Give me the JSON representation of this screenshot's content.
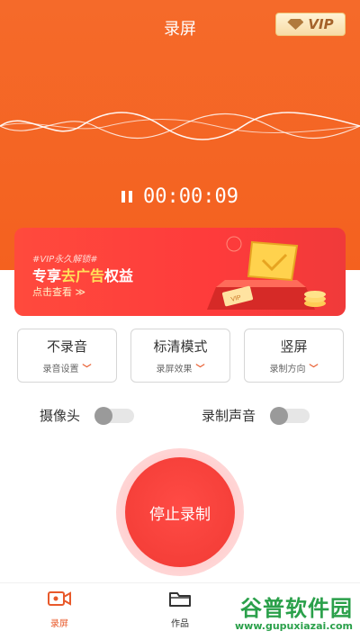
{
  "header": {
    "title": "录屏",
    "vip_label": "VIP"
  },
  "timer": {
    "value": "00:00:09"
  },
  "banner": {
    "tag": "#VIP永久解锁#",
    "title_prefix": "专享",
    "title_highlight": "去广告",
    "title_suffix": "权益",
    "cta": "点击查看 ≫",
    "box_label": "VIP"
  },
  "modes": [
    {
      "title": "不录音",
      "sub": "录音设置"
    },
    {
      "title": "标清模式",
      "sub": "录屏效果"
    },
    {
      "title": "竖屏",
      "sub": "录制方向"
    }
  ],
  "toggles": {
    "camera": {
      "label": "摄像头",
      "on": false
    },
    "audio": {
      "label": "录制声音",
      "on": false
    }
  },
  "stop_button": {
    "label": "停止录制"
  },
  "tabs": [
    {
      "label": "录屏",
      "icon": "video-camera-icon",
      "active": true
    },
    {
      "label": "作品",
      "icon": "folder-icon",
      "active": false
    }
  ],
  "watermark": {
    "top": "谷普软件园",
    "bottom": "www.gupuxiazai.com"
  },
  "colors": {
    "accent": "#f4611f",
    "banner": "#fe3b3b",
    "stop": "#f13a34",
    "vip_text": "#a4622a"
  }
}
